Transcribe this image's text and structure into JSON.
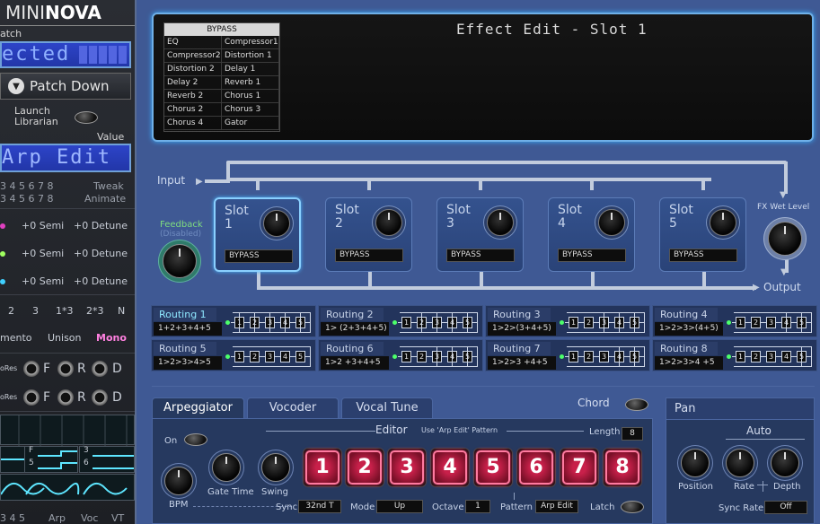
{
  "left_panel": {
    "brand_regular": "MINI",
    "brand_bold": "NOVA",
    "patch_label": "atch",
    "patch_lcd": "ected",
    "patch_down": "Patch Down",
    "launch_line1": "Launch",
    "launch_line2": "Librarian",
    "value_label": "Value",
    "value_lcd": "Arp Edit",
    "tweak_numbers": "3 4 5 6 7 8",
    "tweak_numbers2": "3 4 5 6 7 8",
    "tweak_label": "Tweak",
    "animate_label": "Animate",
    "semi_rows": [
      {
        "semi": "+0 Semi",
        "detune": "+0 Detune",
        "color": "#e040c0"
      },
      {
        "semi": "+0 Semi",
        "detune": "+0 Detune",
        "color": "#a0ff60"
      },
      {
        "semi": "+0 Semi",
        "detune": "+0 Detune",
        "color": "#40d0ff"
      }
    ],
    "unison_values": [
      "2",
      "3",
      "1*3",
      "2*3",
      "N"
    ],
    "mode_left": "mento",
    "mode_mid": "Unison",
    "mode_right": "Mono",
    "res_rows": [
      {
        "label": "oRes",
        "f": "F",
        "r": "R",
        "d": "D"
      },
      {
        "label": "oRes",
        "f": "F",
        "r": "R",
        "d": "D"
      }
    ],
    "wave_labels": [
      "F",
      "3",
      "5",
      "6"
    ],
    "bottom_tabs": [
      "3 4 5",
      "Arp",
      "Voc",
      "VT"
    ]
  },
  "display": {
    "title": "Effect Edit - Slot 1",
    "fx_header": "BYPASS",
    "fx_items": [
      "EQ",
      "Compressor1",
      "Compressor2",
      "Distortion 1",
      "Distortion 2",
      "Delay 1",
      "Delay 2",
      "Reverb 1",
      "Reverb 2",
      "Chorus 1",
      "Chorus 2",
      "Chorus 3",
      "Chorus 4",
      "Gator"
    ]
  },
  "routing": {
    "input_label": "Input",
    "output_label": "Output",
    "feedback_label": "Feedback",
    "feedback_sub": "(Disabled)",
    "wet_label": "FX Wet Level",
    "slots": [
      {
        "label": "Slot",
        "num": "1",
        "fx": "BYPASS"
      },
      {
        "label": "Slot",
        "num": "2",
        "fx": "BYPASS"
      },
      {
        "label": "Slot",
        "num": "3",
        "fx": "BYPASS"
      },
      {
        "label": "Slot",
        "num": "4",
        "fx": "BYPASS"
      },
      {
        "label": "Slot",
        "num": "5",
        "fx": "BYPASS"
      }
    ],
    "routings": [
      {
        "name": "Routing 1",
        "formula": "1+2+3+4+5"
      },
      {
        "name": "Routing 2",
        "formula": "1> (2+3+4+5)"
      },
      {
        "name": "Routing 3",
        "formula": "1>2>(3+4+5)"
      },
      {
        "name": "Routing 4",
        "formula": "1>2>3>(4+5)"
      },
      {
        "name": "Routing 5",
        "formula": "1>2>3>4>5"
      },
      {
        "name": "Routing 6",
        "formula": "1>2 +3+4+5"
      },
      {
        "name": "Routing 7",
        "formula": "1>2>3 +4+5"
      },
      {
        "name": "Routing 8",
        "formula": "1>2>3>4 +5"
      }
    ],
    "box_numbers": [
      "1",
      "2",
      "3",
      "4",
      "5"
    ]
  },
  "arp": {
    "tabs": [
      "Arpeggiator",
      "Vocoder",
      "Vocal Tune"
    ],
    "chord_label": "Chord",
    "on_label": "On",
    "editor_label": "Editor",
    "editor_sub": "Use 'Arp Edit' Pattern",
    "length_label": "Length",
    "length_value": "8",
    "steps": [
      "1",
      "2",
      "3",
      "4",
      "5",
      "6",
      "7",
      "8"
    ],
    "bpm_label": "BPM",
    "gate_label": "Gate Time",
    "swing_label": "Swing",
    "sync_label": "Sync",
    "sync_value": "32nd T",
    "mode_label": "Mode",
    "mode_value": "Up",
    "octave_label": "Octave",
    "octave_value": "1",
    "pattern_label": "Pattern",
    "pattern_value": "Arp Edit",
    "latch_label": "Latch"
  },
  "pan": {
    "title": "Pan",
    "auto_label": "Auto",
    "position_label": "Position",
    "rate_label": "Rate",
    "depth_label": "Depth",
    "sync_rate_label": "Sync Rate",
    "sync_rate_value": "Off"
  }
}
